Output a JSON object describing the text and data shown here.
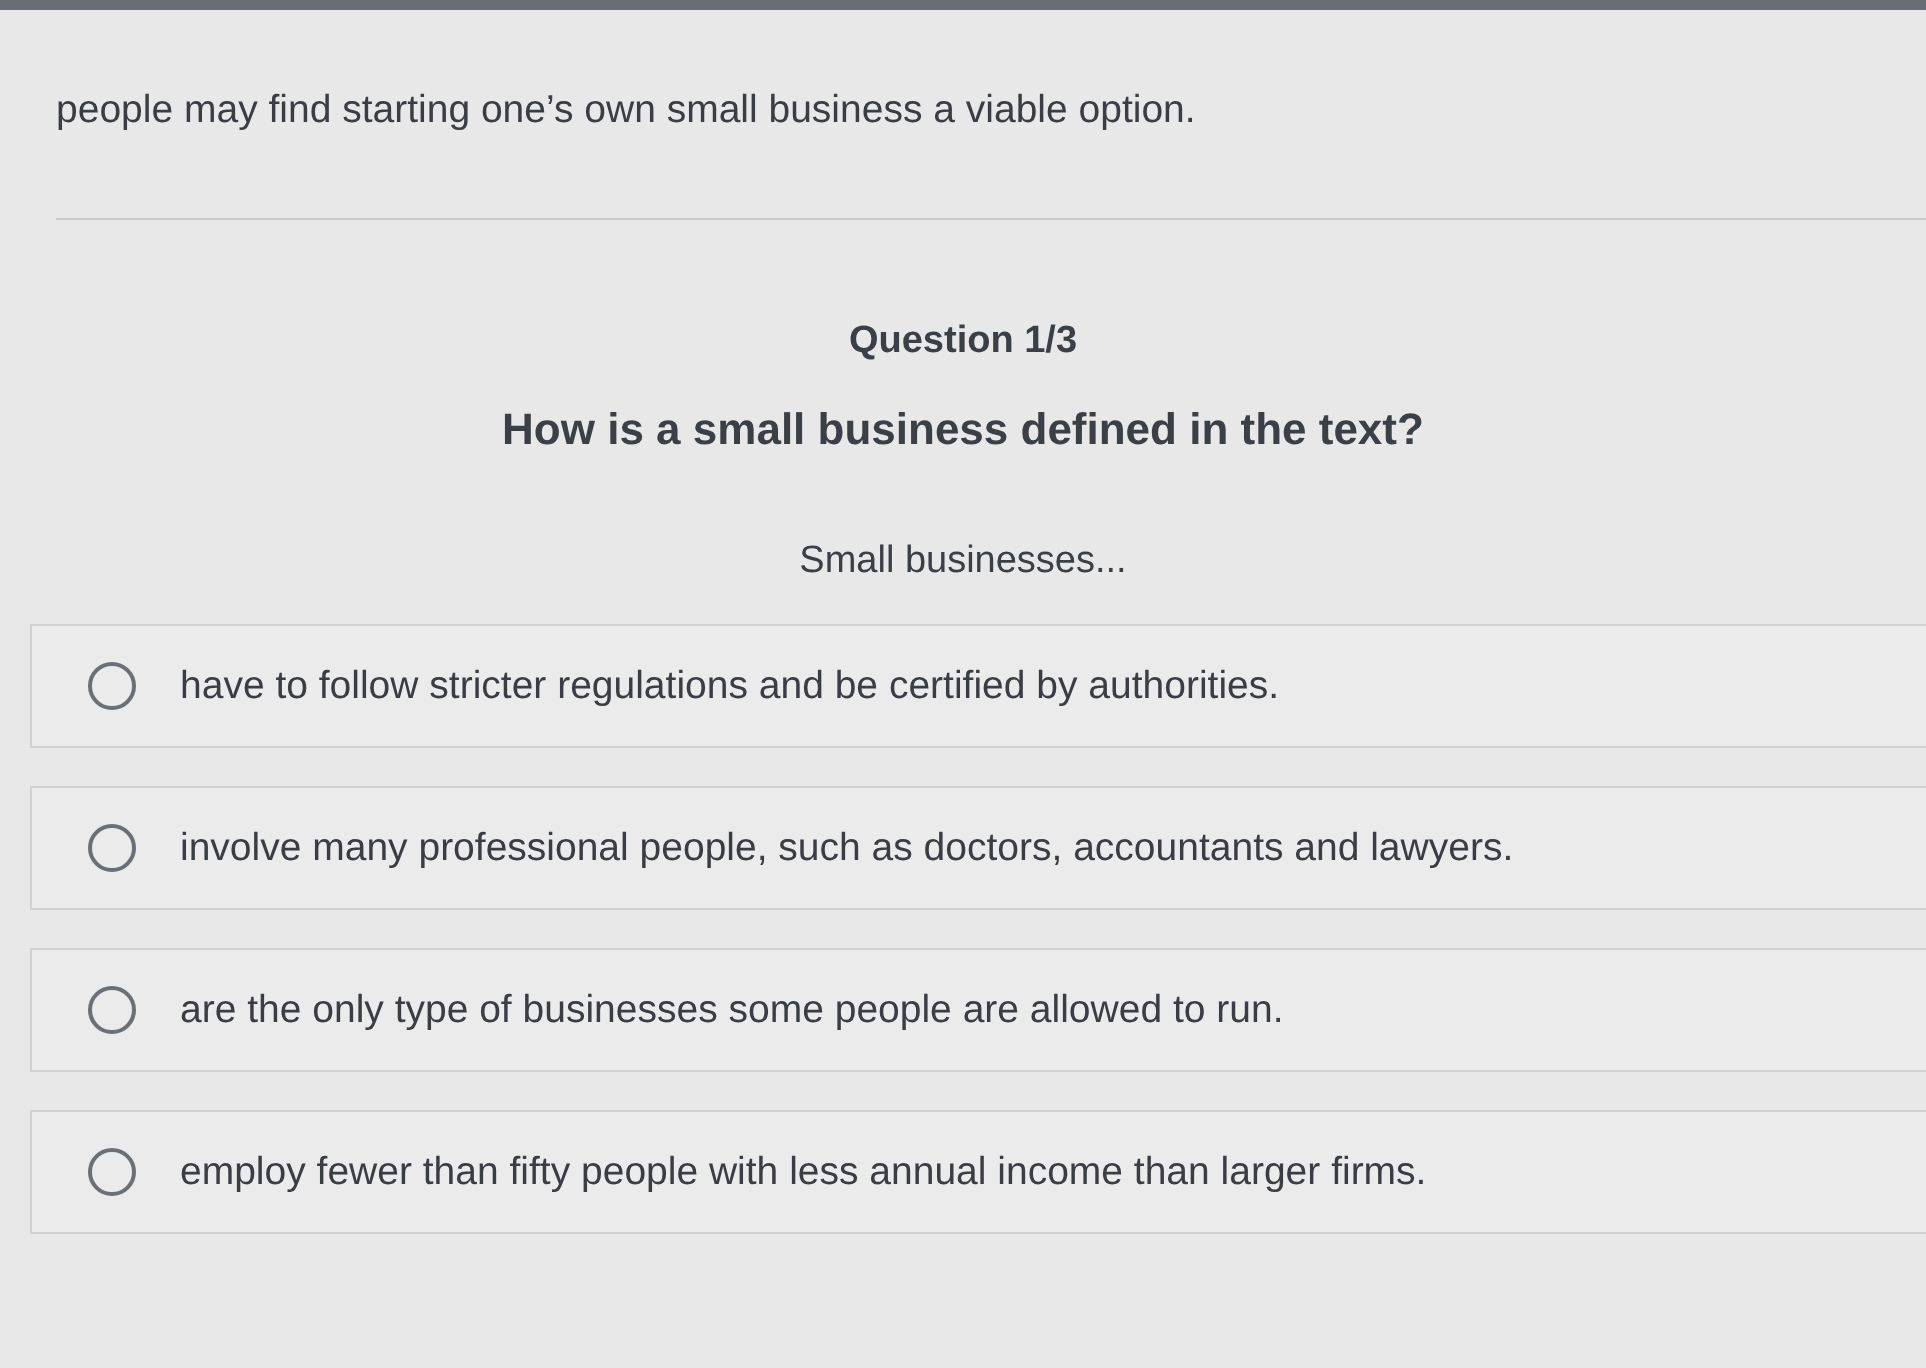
{
  "passage": {
    "text": "people may find starting one’s own small business a viable option."
  },
  "question": {
    "counter": "Question 1/3",
    "title": "How is a small business defined in the text?",
    "prompt": "Small businesses..."
  },
  "options": [
    {
      "label": "have to follow stricter regulations and be certified by authorities.",
      "selected": false
    },
    {
      "label": "involve many professional people, such as doctors, accountants and lawyers.",
      "selected": false
    },
    {
      "label": "are the only type of businesses some people are allowed to run.",
      "selected": false
    },
    {
      "label": "employ fewer than fifty people with less annual income than larger firms.",
      "selected": false
    }
  ]
}
